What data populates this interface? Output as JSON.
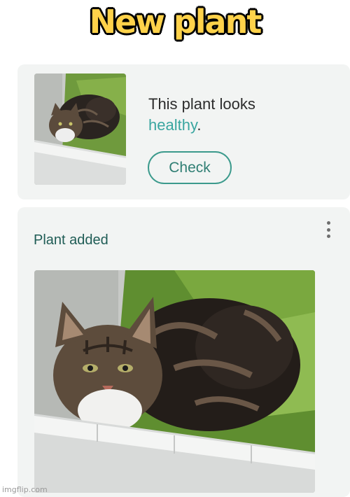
{
  "caption": "New plant",
  "result_card": {
    "status_prefix": "This plant looks",
    "status_value": "healthy",
    "status_suffix": ".",
    "check_button_label": "Check",
    "accent_color": "#3aa6a0"
  },
  "added_card": {
    "title": "Plant added",
    "menu_icon": "kebab-menu-icon"
  },
  "watermark": "imgflip.com"
}
